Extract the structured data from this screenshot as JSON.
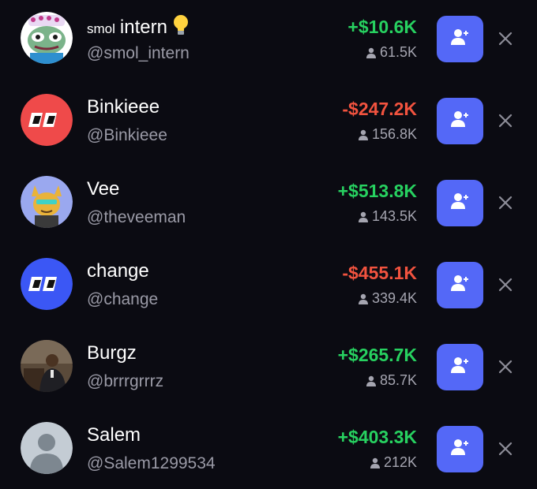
{
  "accent_color": "#5468f7",
  "positive_color": "#27d160",
  "negative_color": "#f2533f",
  "follow_icon": "add-user-icon",
  "dismiss_icon": "close-icon",
  "rows": [
    {
      "name_prefix": "smol",
      "name": "intern",
      "emoji": "lightbulb-icon",
      "handle": "@smol_intern",
      "pnl": "+$10.6K",
      "pnl_sign": "positive",
      "followers": "61.5K",
      "avatar": "frog-avatar"
    },
    {
      "name_prefix": "",
      "name": "Binkieee",
      "handle": "@Binkieee",
      "pnl": "-$247.2K",
      "pnl_sign": "negative",
      "followers": "156.8K",
      "avatar": "logo-avatar-red"
    },
    {
      "name_prefix": "",
      "name": "Vee",
      "handle": "@theveeman",
      "pnl": "+$513.8K",
      "pnl_sign": "positive",
      "followers": "143.5K",
      "avatar": "cat-avatar"
    },
    {
      "name_prefix": "",
      "name": "change",
      "handle": "@change",
      "pnl": "-$455.1K",
      "pnl_sign": "negative",
      "followers": "339.4K",
      "avatar": "logo-avatar-blue"
    },
    {
      "name_prefix": "",
      "name": "Burgz",
      "handle": "@brrrgrrrz",
      "pnl": "+$265.7K",
      "pnl_sign": "positive",
      "followers": "85.7K",
      "avatar": "photo-avatar"
    },
    {
      "name_prefix": "",
      "name": "Salem",
      "handle": "@Salem1299534",
      "pnl": "+$403.3K",
      "pnl_sign": "positive",
      "followers": "212K",
      "avatar": "default-avatar"
    }
  ]
}
